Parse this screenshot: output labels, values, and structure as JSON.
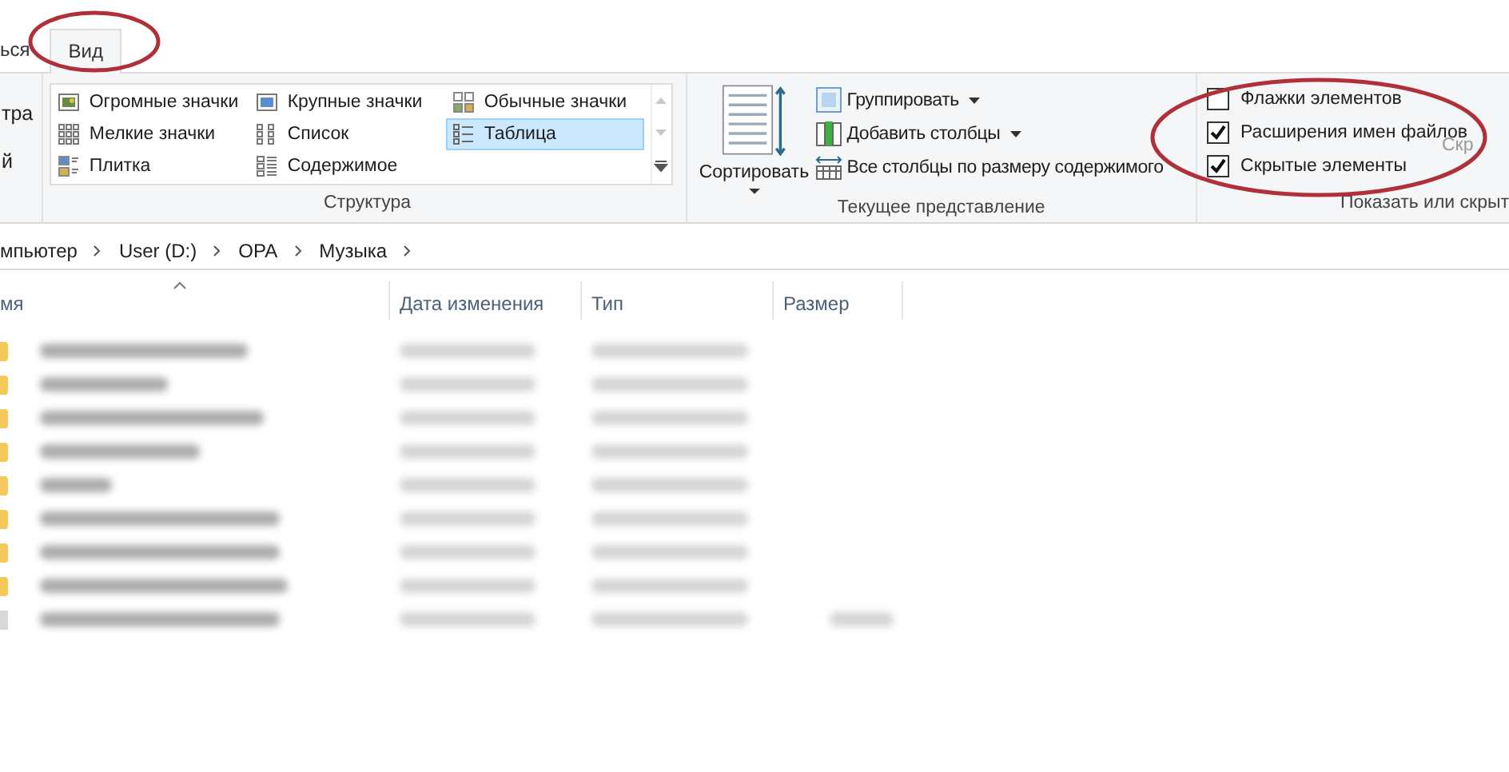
{
  "tabs": [
    {
      "label": "ься",
      "selected": false,
      "circled": false
    },
    {
      "label": "Вид",
      "selected": true,
      "circled": true
    }
  ],
  "ribbon": {
    "partial_group": {
      "items": [
        "тра",
        "й"
      ]
    },
    "layout_group": {
      "label": "Структура",
      "items": [
        {
          "label": "Огромные значки",
          "selected": false
        },
        {
          "label": "Крупные значки",
          "selected": false
        },
        {
          "label": "Обычные значки",
          "selected": false
        },
        {
          "label": "Мелкие значки",
          "selected": false
        },
        {
          "label": "Список",
          "selected": false
        },
        {
          "label": "Таблица",
          "selected": true
        },
        {
          "label": "Плитка",
          "selected": false
        },
        {
          "label": "Содержимое",
          "selected": false
        }
      ]
    },
    "current_view_group": {
      "label": "Текущее представление",
      "sort_button": "Сортировать",
      "items": [
        {
          "label": "Группировать",
          "dropdown": true
        },
        {
          "label": "Добавить столбцы",
          "dropdown": true
        },
        {
          "label": "Все столбцы по размеру содержимого",
          "dropdown": false
        }
      ]
    },
    "show_hide_group": {
      "label": "Показать или скрыт",
      "circled": true,
      "side_label": "Скр",
      "checkboxes": [
        {
          "label": "Флажки элементов",
          "checked": false
        },
        {
          "label": "Расширения имен файлов",
          "checked": true
        },
        {
          "label": "Скрытые элементы",
          "checked": true
        }
      ]
    }
  },
  "address_bar": {
    "crumbs": [
      "мпьютер",
      "User (D:)",
      "OPA",
      "Музыка"
    ]
  },
  "file_list": {
    "columns": [
      {
        "label": "мя",
        "sorted": true
      },
      {
        "label": "Дата изменения",
        "sorted": false
      },
      {
        "label": "Тип",
        "sorted": false
      },
      {
        "label": "Размер",
        "sorted": false
      }
    ],
    "rows": [
      {
        "kind": "folder"
      },
      {
        "kind": "folder"
      },
      {
        "kind": "folder"
      },
      {
        "kind": "folder"
      },
      {
        "kind": "folder"
      },
      {
        "kind": "folder"
      },
      {
        "kind": "folder"
      },
      {
        "kind": "folder"
      },
      {
        "kind": "file"
      }
    ]
  }
}
